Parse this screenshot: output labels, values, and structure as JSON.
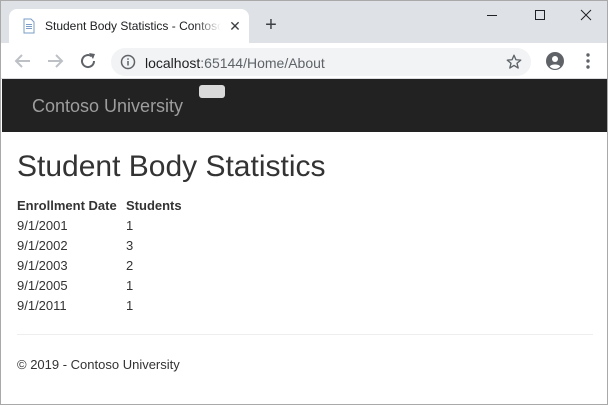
{
  "browser": {
    "tab_title": "Student Body Statistics - Contoso University",
    "tab_close_glyph": "✕",
    "new_tab_glyph": "+",
    "url_host": "localhost",
    "url_rest": ":65144/Home/About"
  },
  "navbar": {
    "brand": "Contoso University"
  },
  "page": {
    "title": "Student Body Statistics"
  },
  "table": {
    "headers": [
      "Enrollment Date",
      "Students"
    ],
    "rows": [
      [
        "9/1/2001",
        "1"
      ],
      [
        "9/1/2002",
        "3"
      ],
      [
        "9/1/2003",
        "2"
      ],
      [
        "9/1/2005",
        "1"
      ],
      [
        "9/1/2011",
        "1"
      ]
    ]
  },
  "footer": {
    "text": "© 2019 - Contoso University"
  },
  "colors": {
    "navbar_bg": "#222222",
    "brand_text": "#9d9d9d",
    "tabstrip_bg": "#dee1e6",
    "omnibox_bg": "#f1f3f4"
  }
}
